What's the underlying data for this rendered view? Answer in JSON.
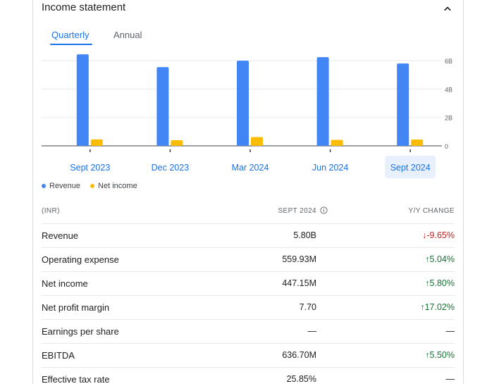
{
  "header": {
    "title": "Income statement"
  },
  "tabs": [
    {
      "label": "Quarterly",
      "active": true
    },
    {
      "label": "Annual",
      "active": false
    }
  ],
  "chart_data": {
    "type": "bar",
    "categories": [
      "Sept 2023",
      "Dec 2023",
      "Mar 2024",
      "Jun 2024",
      "Sept 2024"
    ],
    "selected_category": "Sept 2024",
    "series": [
      {
        "name": "Revenue",
        "color": "#4285f4",
        "values": [
          6.45,
          5.55,
          6.0,
          6.25,
          5.8
        ]
      },
      {
        "name": "Net income",
        "color": "#fbbc04",
        "values": [
          0.45,
          0.4,
          0.62,
          0.42,
          0.447
        ]
      }
    ],
    "ylim": [
      0,
      7
    ],
    "yticks": [
      0,
      2,
      4,
      6
    ],
    "ytick_labels": [
      "0",
      "2B",
      "4B",
      "6B"
    ],
    "grid": true,
    "legend": "bottom-left"
  },
  "table": {
    "headers": {
      "unit": "(INR)",
      "period": "SEPT 2024",
      "change": "Y/Y CHANGE"
    },
    "rows": [
      {
        "label": "Revenue",
        "value": "5.80B",
        "change": "-9.65%",
        "trend": "down"
      },
      {
        "label": "Operating expense",
        "value": "559.93M",
        "change": "5.04%",
        "trend": "up"
      },
      {
        "label": "Net income",
        "value": "447.15M",
        "change": "5.80%",
        "trend": "up"
      },
      {
        "label": "Net profit margin",
        "value": "7.70",
        "change": "17.02%",
        "trend": "up"
      },
      {
        "label": "Earnings per share",
        "value": "—",
        "change": "—",
        "trend": "none"
      },
      {
        "label": "EBITDA",
        "value": "636.70M",
        "change": "5.50%",
        "trend": "up"
      },
      {
        "label": "Effective tax rate",
        "value": "25.85%",
        "change": "—",
        "trend": "none"
      }
    ]
  },
  "colors": {
    "accent": "#1a73e8",
    "positive": "#137333",
    "negative": "#c5221f"
  }
}
